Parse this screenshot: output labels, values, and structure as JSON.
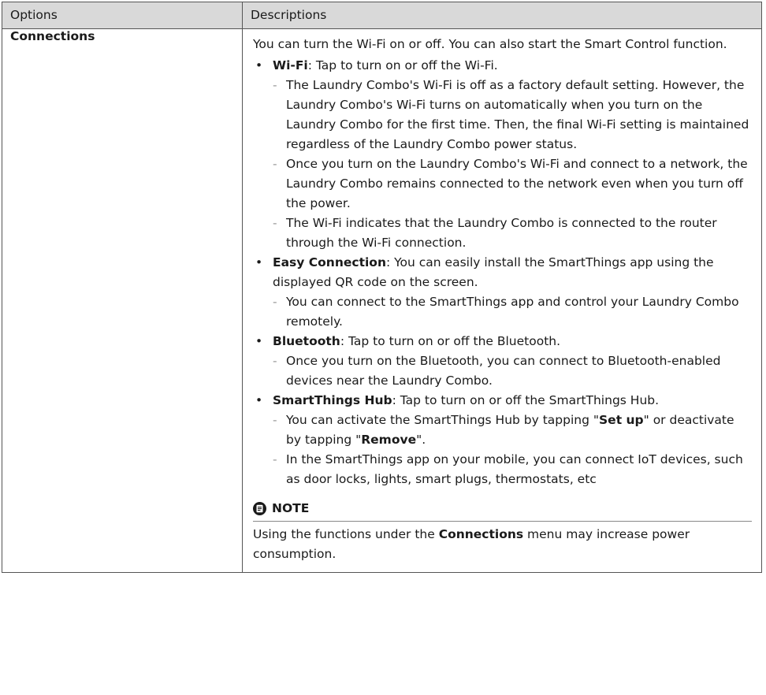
{
  "table": {
    "headers": {
      "options": "Options",
      "descriptions": "Descriptions"
    },
    "row": {
      "option": "Connections",
      "intro": "You can turn the Wi-Fi on or off. You can also start the Smart Control function.",
      "items": [
        {
          "term": "Wi-Fi",
          "text": ": Tap to turn on or off the Wi-Fi.",
          "subs": [
            "The Laundry Combo's Wi-Fi is off as a factory default setting. However, the Laundry Combo's Wi-Fi turns on automatically when you turn on the Laundry Combo for the first time. Then, the final Wi-Fi setting is maintained regardless of the Laundry Combo power status.",
            "Once you turn on the Laundry Combo's Wi-Fi and connect to a network, the Laundry Combo remains connected to the network even when you turn off the power.",
            "The Wi-Fi indicates that the Laundry Combo is connected to the router through the Wi-Fi connection."
          ]
        },
        {
          "term": "Easy Connection",
          "text": ": You can easily install the SmartThings app using the displayed QR code on the screen.",
          "subs": [
            "You can connect to the SmartThings app and control your Laundry Combo remotely."
          ]
        },
        {
          "term": "Bluetooth",
          "text": ": Tap to turn on or off the Bluetooth.",
          "subs": [
            "Once you turn on the Bluetooth, you can connect to Bluetooth-enabled devices near the Laundry Combo."
          ]
        },
        {
          "term": "SmartThings Hub",
          "text": ": Tap to turn on or off the SmartThings Hub.",
          "subs_special": {
            "hub_pre": "You can activate the SmartThings Hub by tapping \"",
            "hub_setup": "Set up",
            "hub_mid": "\" or deactivate by tapping \"",
            "hub_remove": "Remove",
            "hub_post": "\"."
          },
          "subs": [
            "In the SmartThings app on your mobile, you can connect IoT devices, such as door locks, lights, smart plugs, thermostats, etc"
          ]
        }
      ],
      "note": {
        "icon": "note-icon",
        "title": "NOTE",
        "pre": "Using the functions under the ",
        "bold": "Connections",
        "post": " menu may increase power consumption."
      }
    }
  }
}
